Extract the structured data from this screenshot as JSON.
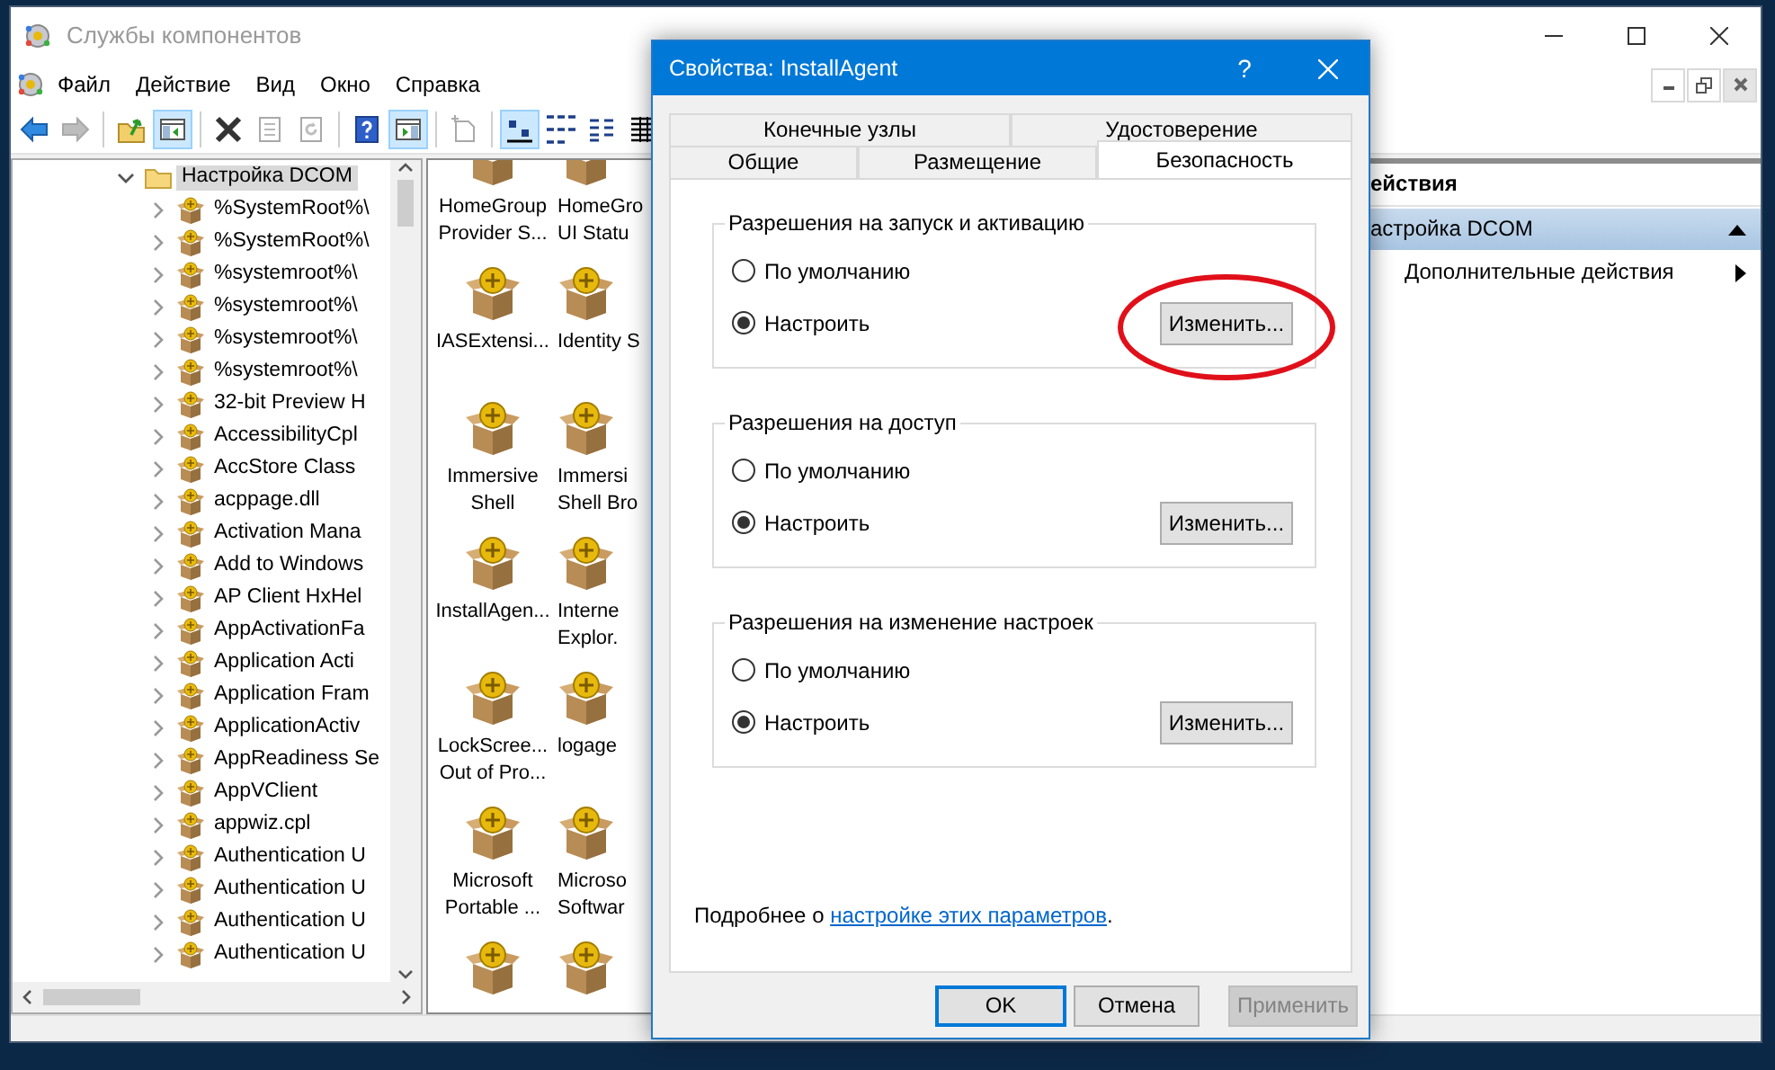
{
  "main_window": {
    "title": "Службы компонентов",
    "menu": [
      {
        "label": "Файл"
      },
      {
        "label": "Действие"
      },
      {
        "label": "Вид"
      },
      {
        "label": "Окно"
      },
      {
        "label": "Справка"
      }
    ],
    "toolbar": [
      {
        "kind": "back",
        "selected": false,
        "disabled": false
      },
      {
        "kind": "forward",
        "selected": false,
        "disabled": true
      },
      {
        "kind": "separator"
      },
      {
        "kind": "folder-up",
        "selected": false,
        "disabled": false
      },
      {
        "kind": "console-tree",
        "selected": true,
        "disabled": false
      },
      {
        "kind": "separator"
      },
      {
        "kind": "delete",
        "selected": false,
        "disabled": false
      },
      {
        "kind": "properties",
        "selected": false,
        "disabled": true
      },
      {
        "kind": "refresh",
        "selected": false,
        "disabled": true
      },
      {
        "kind": "separator"
      },
      {
        "kind": "help",
        "selected": false,
        "disabled": false
      },
      {
        "kind": "action-pane",
        "selected": true,
        "disabled": false
      },
      {
        "kind": "separator"
      },
      {
        "kind": "new-window",
        "selected": false,
        "disabled": true
      },
      {
        "kind": "separator"
      },
      {
        "kind": "large-icons",
        "selected": true,
        "disabled": false
      },
      {
        "kind": "small-icons",
        "selected": false,
        "disabled": false
      },
      {
        "kind": "list",
        "selected": false,
        "disabled": false
      },
      {
        "kind": "details",
        "selected": false,
        "disabled": false
      }
    ]
  },
  "tree": {
    "items": [
      {
        "label": "Настройка DCOM",
        "expanded": true,
        "selected": true,
        "children": [
          {
            "label": "%SystemRoot%\\",
            "expanded": false,
            "selected": false
          },
          {
            "label": "%SystemRoot%\\",
            "expanded": false,
            "selected": false
          },
          {
            "label": "%systemroot%\\",
            "expanded": false,
            "selected": false
          },
          {
            "label": "%systemroot%\\",
            "expanded": false,
            "selected": false
          },
          {
            "label": "%systemroot%\\",
            "expanded": false,
            "selected": false
          },
          {
            "label": "%systemroot%\\",
            "expanded": false,
            "selected": false
          },
          {
            "label": "32-bit Preview H",
            "expanded": false,
            "selected": false
          },
          {
            "label": "AccessibilityCpl",
            "expanded": false,
            "selected": false
          },
          {
            "label": "AccStore Class",
            "expanded": false,
            "selected": false
          },
          {
            "label": "acppage.dll",
            "expanded": false,
            "selected": false
          },
          {
            "label": "Activation Mana",
            "expanded": false,
            "selected": false
          },
          {
            "label": "Add to Windows",
            "expanded": false,
            "selected": false
          },
          {
            "label": "AP Client HxHel",
            "expanded": false,
            "selected": false
          },
          {
            "label": "AppActivationFa",
            "expanded": false,
            "selected": false
          },
          {
            "label": "Application Acti",
            "expanded": false,
            "selected": false
          },
          {
            "label": "Application Fram",
            "expanded": false,
            "selected": false
          },
          {
            "label": "ApplicationActiv",
            "expanded": false,
            "selected": false
          },
          {
            "label": "AppReadiness Se",
            "expanded": false,
            "selected": false
          },
          {
            "label": "AppVClient",
            "expanded": false,
            "selected": false
          },
          {
            "label": "appwiz.cpl",
            "expanded": false,
            "selected": false
          },
          {
            "label": "Authentication U",
            "expanded": false,
            "selected": false
          },
          {
            "label": "Authentication U",
            "expanded": false,
            "selected": false
          },
          {
            "label": "Authentication U",
            "expanded": false,
            "selected": false
          },
          {
            "label": "Authentication U",
            "expanded": false,
            "selected": false
          }
        ]
      }
    ]
  },
  "icons": [
    {
      "kind": "component",
      "label": "HomeGroup\nProvider S..."
    },
    {
      "kind": "component",
      "label": "HomeGro\nUI Statu"
    },
    {
      "kind": "component",
      "label": "IASExtensi..."
    },
    {
      "kind": "component",
      "label": "Identity S"
    },
    {
      "kind": "component",
      "label": "Immersive\nShell"
    },
    {
      "kind": "component",
      "label": "Immersi\nShell Bro"
    },
    {
      "kind": "component",
      "label": "InstallAgen..."
    },
    {
      "kind": "component",
      "label": "Interne\nExplor."
    },
    {
      "kind": "component",
      "label": "LockScree...\nOut of Pro..."
    },
    {
      "kind": "component",
      "label": "logage"
    },
    {
      "kind": "component",
      "label": "Microsoft\nPortable ..."
    },
    {
      "kind": "component",
      "label": "Microso\nSoftwar"
    },
    {
      "kind": "component"
    },
    {
      "kind": "component"
    }
  ],
  "actions": {
    "header": "ействия",
    "items": [
      {
        "kind": "group",
        "label": "астройка DCOM",
        "selected": true
      },
      {
        "kind": "submenu",
        "label": "Дополнительные действия",
        "selected": false
      }
    ]
  },
  "dialog": {
    "title": "Свойства: InstallAgent",
    "help": "?",
    "tab_rows": [
      [
        {
          "label": "Конечные узлы",
          "selected": false
        },
        {
          "label": "Удостоверение",
          "selected": false
        }
      ],
      [
        {
          "label": "Общие",
          "selected": false
        },
        {
          "label": "Размещение",
          "selected": false
        },
        {
          "label": "Безопасность",
          "selected": true
        }
      ]
    ],
    "groups": [
      {
        "title": "Разрешения на запуск и активацию",
        "options": [
          {
            "label": "По умолчанию",
            "selected": false
          },
          {
            "label": "Настроить",
            "selected": true
          }
        ],
        "button": "Изменить...",
        "annotated": true
      },
      {
        "title": "Разрешения на доступ",
        "options": [
          {
            "label": "По умолчанию",
            "selected": false
          },
          {
            "label": "Настроить",
            "selected": true
          }
        ],
        "button": "Изменить...",
        "annotated": false
      },
      {
        "title": "Разрешения на изменение настроек",
        "options": [
          {
            "label": "По умолчанию",
            "selected": false
          },
          {
            "label": "Настроить",
            "selected": true
          }
        ],
        "button": "Изменить...",
        "annotated": false
      }
    ],
    "footer": {
      "text": "Подробнее о ",
      "link": "настройке этих параметров",
      "tail": "."
    },
    "buttons": [
      {
        "label": "OK",
        "kind": "default",
        "disabled": false
      },
      {
        "label": "Отмена",
        "kind": "normal",
        "disabled": false
      },
      {
        "label": "Применить",
        "kind": "normal",
        "disabled": true
      }
    ]
  }
}
